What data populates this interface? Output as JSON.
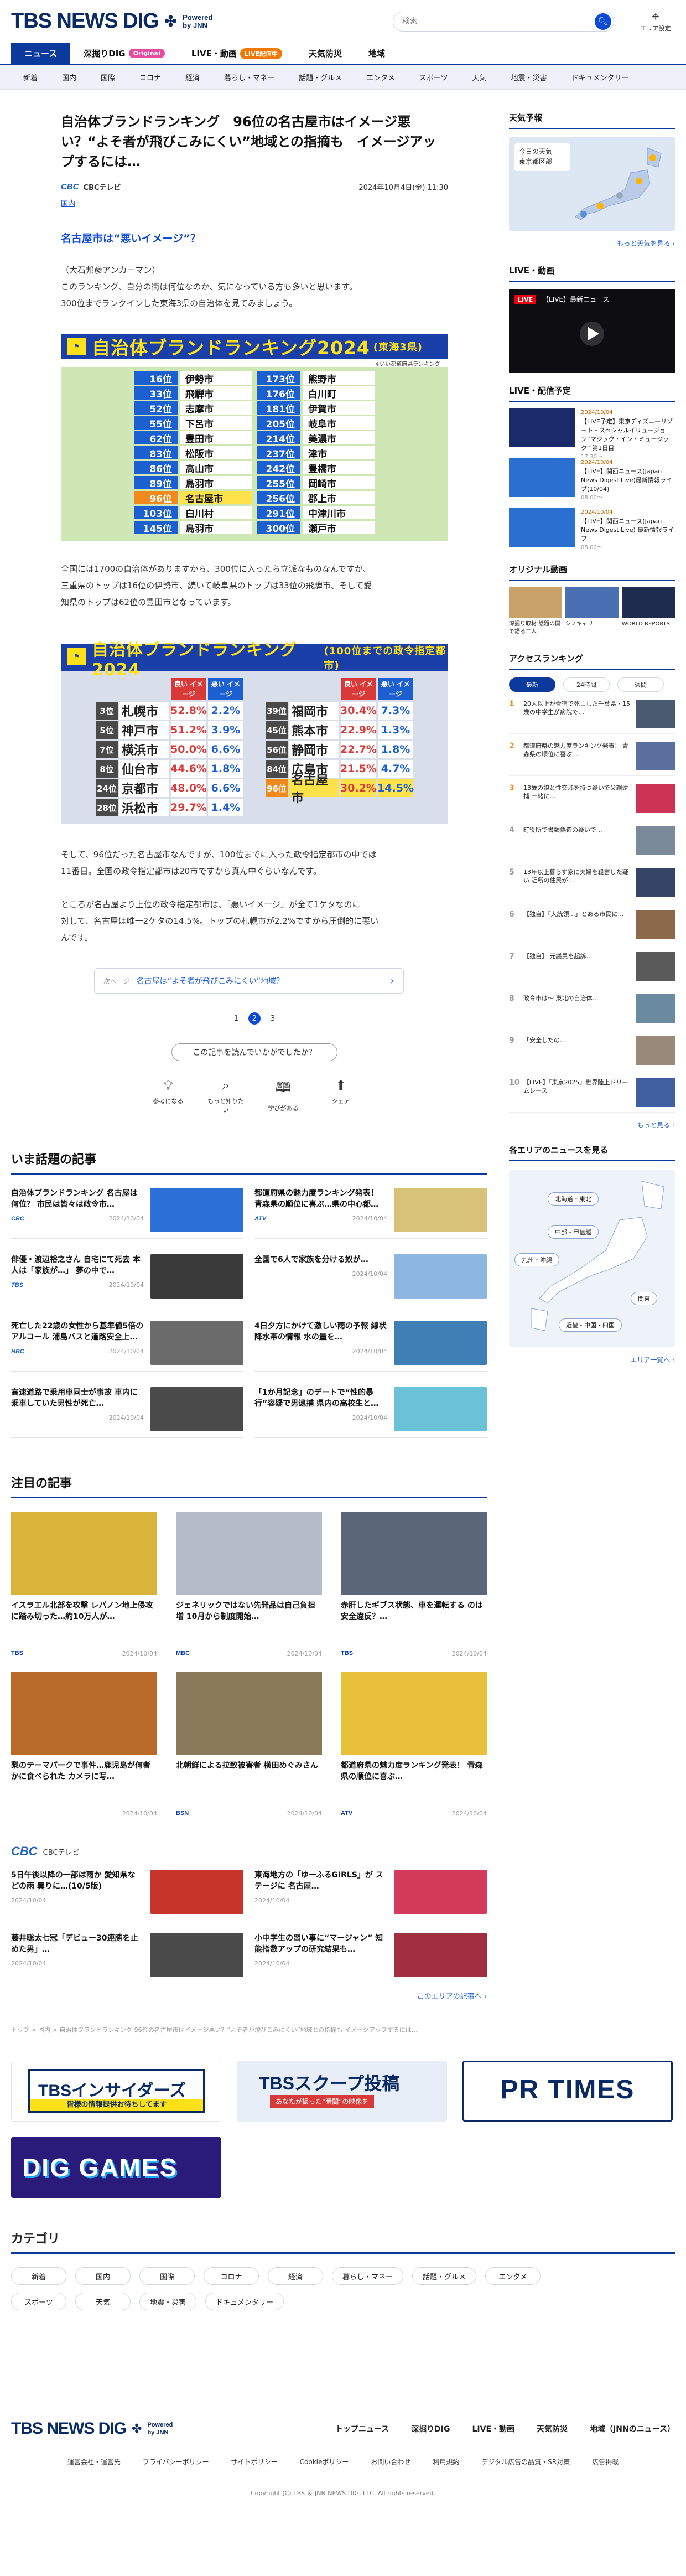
{
  "header": {
    "logo": "TBS NEWS DIG",
    "logo_powered": "Powered",
    "logo_by": "by JNN",
    "search_placeholder": "検索",
    "area_label": "エリア設定"
  },
  "nav_primary": [
    {
      "label": "ニュース",
      "active": true
    },
    {
      "label": "深掘りDIG",
      "badge": "Original"
    },
    {
      "label": "LIVE・動画",
      "badge": "LIVE配信中"
    },
    {
      "label": "天気防災"
    },
    {
      "label": "地域"
    }
  ],
  "nav_secondary": [
    "新着",
    "国内",
    "国際",
    "コロナ",
    "経済",
    "暮らし・マネー",
    "話題・グルメ",
    "エンタメ",
    "スポーツ",
    "天気",
    "地震・災害",
    "ドキュメンタリー"
  ],
  "article": {
    "title": "自治体ブランドランキング　96位の名古屋市はイメージ悪い？“よそ者が飛びこみにくい”地域との指摘も　イメージアップするには…",
    "source": "CBCテレビ",
    "date": "2024年10月4日(金) 11:30",
    "tag": "国内",
    "heading": "名古屋市は“悪いイメージ”？",
    "p1": "（大石邦彦アンカーマン）",
    "p2": "このランキング、自分の街は何位なのか、気になっている方も多いと思います。",
    "p3": "300位までランクインした東海3県の自治体を見てみましょう。",
    "p4": "全国には1700の自治体がありますから、300位に入ったら立派なものなんですが、",
    "p5": "三重県のトップは16位の伊勢市、続いて岐阜県のトップは33位の飛騨市、そして愛",
    "p6": "知県のトップは62位の豊田市となっています。",
    "p7": "そして、96位だった名古屋市なんですが、100位までに入った政令指定都市の中では",
    "p8": "11番目。全国の政令指定都市は20市ですから真ん中ぐらいなんです。",
    "p9": "ところが名古屋より上位の政令指定都市は、「悪いイメージ」が全て1ケタなのに",
    "p10": "対して、名古屋は唯一2ケタの14.5%。トップの札幌市が2.2%ですから圧倒的に悪い",
    "p11": "んです。",
    "next_label": "次ページ",
    "next_title": "名古屋は“よそ者が飛びこみにくい”地域？",
    "pages": [
      "1",
      "2",
      "3"
    ],
    "read_button": "この記事を読んでいかがでしたか？",
    "reactions": [
      "参考になる",
      "もっと知りたい",
      "学びがある",
      "シェア"
    ]
  },
  "rank1": {
    "title": "自治体ブランドランキング2024",
    "sub": "(東海3県)",
    "note": "※いい都道府県ランキング",
    "left": [
      [
        "16位",
        "伊勢市",
        false
      ],
      [
        "33位",
        "飛騨市",
        false
      ],
      [
        "52位",
        "志摩市",
        false
      ],
      [
        "55位",
        "下呂市",
        false
      ],
      [
        "62位",
        "豊田市",
        false
      ],
      [
        "83位",
        "松阪市",
        false
      ],
      [
        "86位",
        "高山市",
        false
      ],
      [
        "89位",
        "鳥羽市",
        false
      ],
      [
        "96位",
        "名古屋市",
        true
      ],
      [
        "103位",
        "白川村",
        false
      ],
      [
        "145位",
        "鳥羽市",
        false
      ]
    ],
    "right": [
      [
        "173位",
        "熊野市",
        false
      ],
      [
        "176位",
        "白川町",
        false
      ],
      [
        "181位",
        "伊賀市",
        false
      ],
      [
        "205位",
        "岐阜市",
        false
      ],
      [
        "214位",
        "美濃市",
        false
      ],
      [
        "237位",
        "津市",
        false
      ],
      [
        "242位",
        "豊橋市",
        false
      ],
      [
        "255位",
        "岡崎市",
        false
      ],
      [
        "256位",
        "郡上市",
        false
      ],
      [
        "291位",
        "中津川市",
        false
      ],
      [
        "300位",
        "瀬戸市",
        false
      ]
    ]
  },
  "rank2": {
    "title": "自治体ブランドランキング2024",
    "sub": "(100位までの政令指定都市)",
    "h_good": "良い イメージ",
    "h_bad": "悪い イメージ",
    "left": [
      [
        "3位",
        "札幌市",
        "52.8%",
        "2.2%"
      ],
      [
        "5位",
        "神戸市",
        "51.2%",
        "3.9%"
      ],
      [
        "7位",
        "横浜市",
        "50.0%",
        "6.6%"
      ],
      [
        "8位",
        "仙台市",
        "44.6%",
        "1.8%"
      ],
      [
        "24位",
        "京都市",
        "48.0%",
        "6.6%"
      ],
      [
        "28位",
        "浜松市",
        "29.7%",
        "1.4%"
      ]
    ],
    "right": [
      [
        "39位",
        "福岡市",
        "30.4%",
        "7.3%"
      ],
      [
        "45位",
        "熊本市",
        "22.9%",
        "1.3%"
      ],
      [
        "56位",
        "静岡市",
        "22.7%",
        "1.8%"
      ],
      [
        "84位",
        "広島市",
        "21.5%",
        "4.7%"
      ],
      [
        "96位",
        "名古屋市",
        "30.2%",
        "14.5%"
      ]
    ]
  },
  "trending": {
    "heading": "いま話題の記事",
    "items": [
      {
        "text": "自治体ブランドランキング 名古屋は何位？ 市民は皆々は政令市…",
        "src": "CBC",
        "date": "2024/10/04"
      },
      {
        "text": "都道府県の魅力度ランキング発表！ 青森県の順位に喜ぶ…県の中心都…",
        "src": "ATV",
        "date": "2024/10/04"
      },
      {
        "text": "俳優・渡辺裕之さん 自宅にて死去 本人は「家族が…」 夢の中で…",
        "src": "TBS",
        "date": "2024/10/04"
      },
      {
        "text": "全国で6人で家族を分ける奴が…",
        "src": "",
        "date": "2024/10/04"
      },
      {
        "text": "死亡した22歳の女性から基準値5倍のアルコール 浦島バスと道路安全上…",
        "src": "HBC",
        "date": "2024/10/04"
      },
      {
        "text": "4日夕方にかけて激しい雨の予報 線状降水帯の情報 水の量を…",
        "src": "",
        "date": "2024/10/04"
      },
      {
        "text": "高速道路で乗用車同士が事故 車内に乗車していた男性が死亡…",
        "src": "",
        "date": "2024/10/04"
      },
      {
        "text": "「1か月記念」のデートで“性的暴行”容疑で男逮捕 県内の高校生と…",
        "src": "",
        "date": "2024/10/04"
      }
    ]
  },
  "featured": {
    "heading": "注目の記事",
    "items": [
      {
        "text": "イスラエル北部を攻撃 レバノン地上侵攻に踏み切った…約10万人が…",
        "src": "TBS",
        "date": "2024/10/04"
      },
      {
        "text": "ジェネリックではない先発品は自己負担増 10月から制度開始…",
        "src": "MBC",
        "date": "2024/10/04"
      },
      {
        "text": "赤肝したギブス状態、車を運転する のは安全違反？…",
        "src": "TBS",
        "date": "2024/10/04"
      },
      {
        "text": "梨のテーマパークで事件…鹿児島が何者かに食べられた カメラに写…",
        "src": "",
        "date": "2024/10/04"
      },
      {
        "text": "北朝鮮による拉致被害者 横田めぐみさん",
        "src": "BSN",
        "date": "2024/10/04"
      },
      {
        "text": "都道府県の魅力度ランキング発表！ 青森県の順位に喜ぶ…",
        "src": "ATV",
        "date": "2024/10/04"
      }
    ]
  },
  "cbc": {
    "label": "CBCテレビ",
    "items": [
      {
        "text": "5日午後以降の一部は雨か 愛知県などの雨 曇りに…(10/5版)",
        "date": "2024/10/04"
      },
      {
        "text": "東海地方の「ゆーふるGIRLS」が ステージに 名古屋…",
        "date": "2024/10/04"
      },
      {
        "text": "藤井聡太七冠「デビュー30連勝を止めた男」…",
        "date": "2024/10/04"
      },
      {
        "text": "小中学生の習い事に“マージャン” 知能指数アップの研究結果も…",
        "date": "2024/10/04"
      }
    ],
    "more": "このエリアの記事へ ›"
  },
  "breadcrumb": "トップ > 国内 > 自治体ブランドランキング 96位の名古屋市はイメージ悪い？“よそ者が飛びこみにくい”地域との指摘も イメージアップするには…",
  "banners": {
    "b1": "TBSインサイダーズ",
    "b1_sub": "皆様の情報提供お待ちしてます",
    "b2": "TBSスクープ投稿",
    "b2_sub": "あなたが撮った“瞬間”の映像を",
    "b3": "PR TIMES",
    "b4": "DIG GAMES"
  },
  "categories": {
    "heading": "カテゴリ",
    "items": [
      "新着",
      "国内",
      "国際",
      "コロナ",
      "経済",
      "暮らし・マネー",
      "話題・グルメ",
      "エンタメ",
      "スポーツ",
      "天気",
      "地震・災害",
      "ドキュメンタリー"
    ]
  },
  "footer": {
    "links1": [
      "トップニュース",
      "深掘りDIG",
      "LIVE・動画",
      "天気防災",
      "地域（JNNのニュース）"
    ],
    "links2": [
      "運営会社・運営先",
      "プライバシーポリシー",
      "サイトポリシー",
      "Cookieポリシー",
      "お問い合わせ",
      "利用規約",
      "デジタル広告の品質・SR対策",
      "広告掲載"
    ],
    "copyright": "Copyright (C) TBS ＆ JNN NEWS DIG, LLC. All rights reserved."
  },
  "sidebar": {
    "weather_h": "天気予報",
    "weather_card1": "今日の天気",
    "weather_card2": "東京都区部",
    "weather_more": "もっと天気を見る ›",
    "live_h": "LIVE・動画",
    "live_tag": "LIVE",
    "live_title": "【LIVE】最新ニュース",
    "live_plan_h": "LIVE・配信予定",
    "live_items": [
      {
        "date": "2024/10/04",
        "text": "【LIVE予定】東京ディズニーリゾート・スペシャルイリュージョン“マジック・イン・ミュージック” 第1日目",
        "time": "17:30〜"
      },
      {
        "date": "2024/10/04",
        "text": "【LIVE】関西ニュース(Japan News Digest Live)最新情報ライブ(10/04)",
        "time": "08:00〜"
      },
      {
        "date": "2024/10/04",
        "text": "【LIVE】関西ニュース(Japan News Digest Live) 最新情報ライブ",
        "time": "08:00〜"
      }
    ],
    "orig_h": "オリジナル動画",
    "orig": [
      "深掘り取材 話題の国で語る二人",
      "シノキャリ",
      "WORLD REPORTS"
    ],
    "rank_h": "アクセスランキング",
    "rank_tabs": [
      "最新",
      "24時間",
      "週間"
    ],
    "rank_items": [
      "20人以上が合宿で死亡した千葉県・15歳の中学生が病院で…",
      "都道府県の魅力度ランキング発表！ 青森県の順位に喜ぶ…",
      "13歳の娘と性交渉を持つ疑いで父親逮捕 一緒に…",
      "町役所で書類偽造の疑いで…",
      "13年以上暮らす家に夫婦を殺害した疑い 近所の住民が…",
      "【独自】「大統領…」とある市民に…",
      "【独自】 元議員を起訴…",
      "政令市は〜 東北の自治体…",
      "「安全したの…",
      "【LIVE】「東京2025」世界陸上ドリームレース"
    ],
    "rank_more": "もっと見る ›",
    "area_h": "各エリアのニュースを見る",
    "area_pills": [
      "北海道・東北",
      "中部・甲信越",
      "九州・沖縄",
      "関東",
      "近畿・中国・四国"
    ],
    "area_more": "エリア一覧へ ›"
  }
}
